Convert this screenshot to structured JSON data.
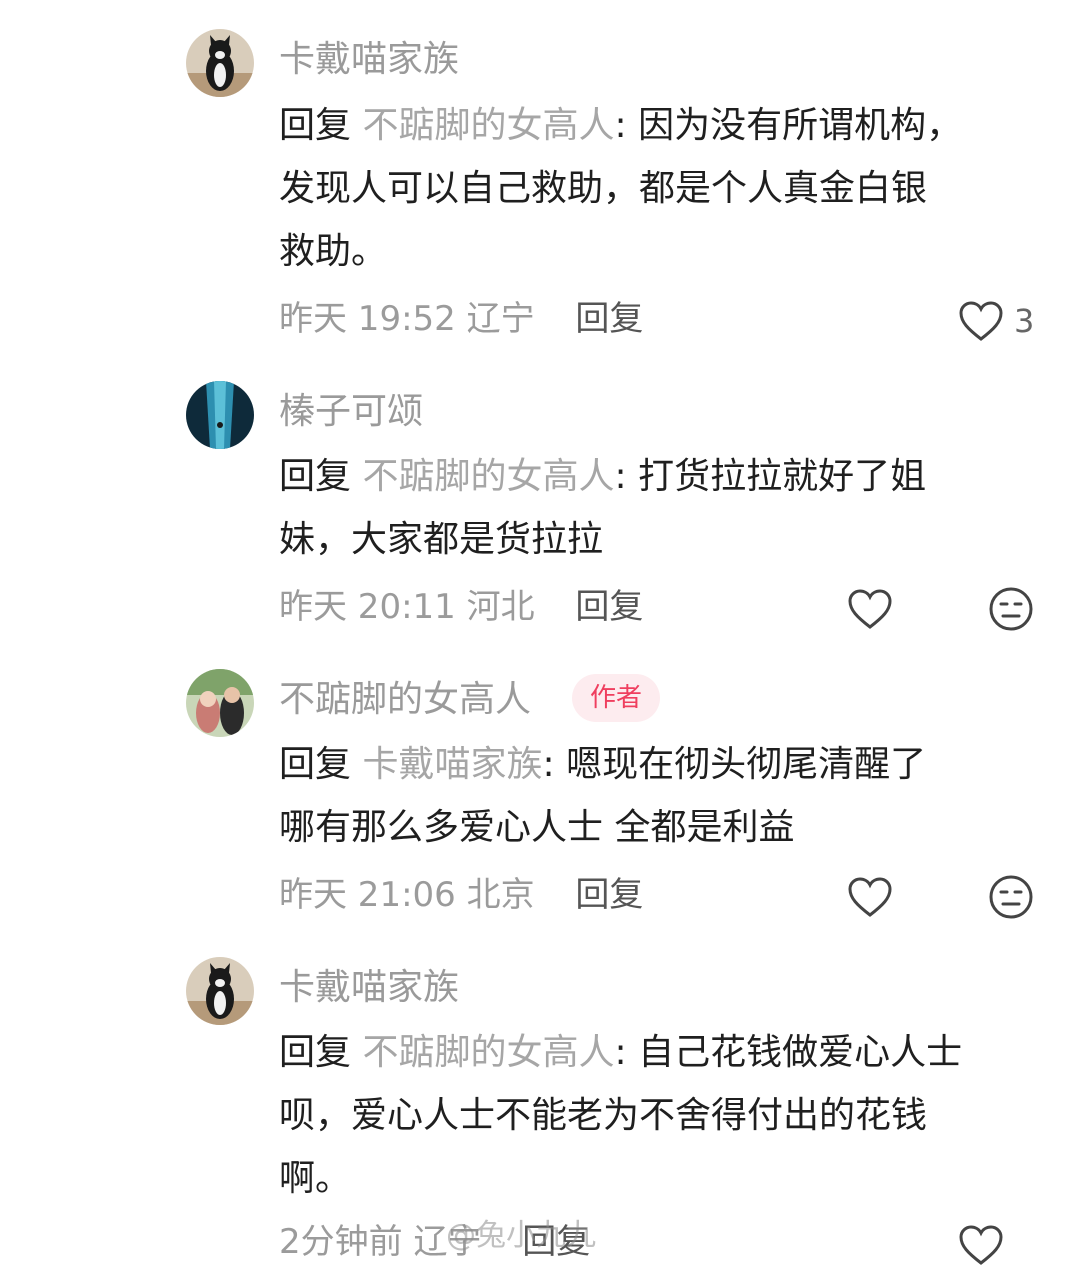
{
  "comments": [
    {
      "author": "卡戴喵家族",
      "reply_word": "回复",
      "reply_to": "不踮脚的女高人",
      "text_lines": [
        "因为没有所谓机构，",
        "发现人可以自己救助，都是个人真金白银",
        "救助。"
      ],
      "time": "昨天 19:52",
      "location": "辽宁",
      "reply_label": "回复",
      "likes": "3"
    },
    {
      "author": "榛子可颂",
      "reply_word": "回复",
      "reply_to": "不踮脚的女高人",
      "text_lines": [
        "打货拉拉就好了姐",
        "妹，大家都是货拉拉"
      ],
      "time": "昨天 20:11",
      "location": "河北",
      "reply_label": "回复"
    },
    {
      "author": "不踮脚的女高人",
      "badge": "作者",
      "reply_word": "回复",
      "reply_to": "卡戴喵家族",
      "text_lines": [
        "嗯现在彻头彻尾清醒了",
        "哪有那么多爱心人士 全都是利益"
      ],
      "time": "昨天 21:06",
      "location": "北京",
      "reply_label": "回复"
    },
    {
      "author": "卡戴喵家族",
      "reply_word": "回复",
      "reply_to": "不踮脚的女高人",
      "text_lines": [
        "自己花钱做爱心人士",
        "呗，爱心人士不能老为不舍得付出的花钱",
        "啊。"
      ],
      "time": "2分钟前",
      "location": "辽宁",
      "reply_label": "回复"
    }
  ],
  "watermark": "@兔小九九",
  "colors": {
    "name_gray": "#9a9a9a",
    "badge_bg": "#fdecef",
    "badge_text": "#ef3f5f"
  },
  "icons": {
    "like": "heart-outline-icon",
    "emoji": "neutral-face-icon"
  }
}
